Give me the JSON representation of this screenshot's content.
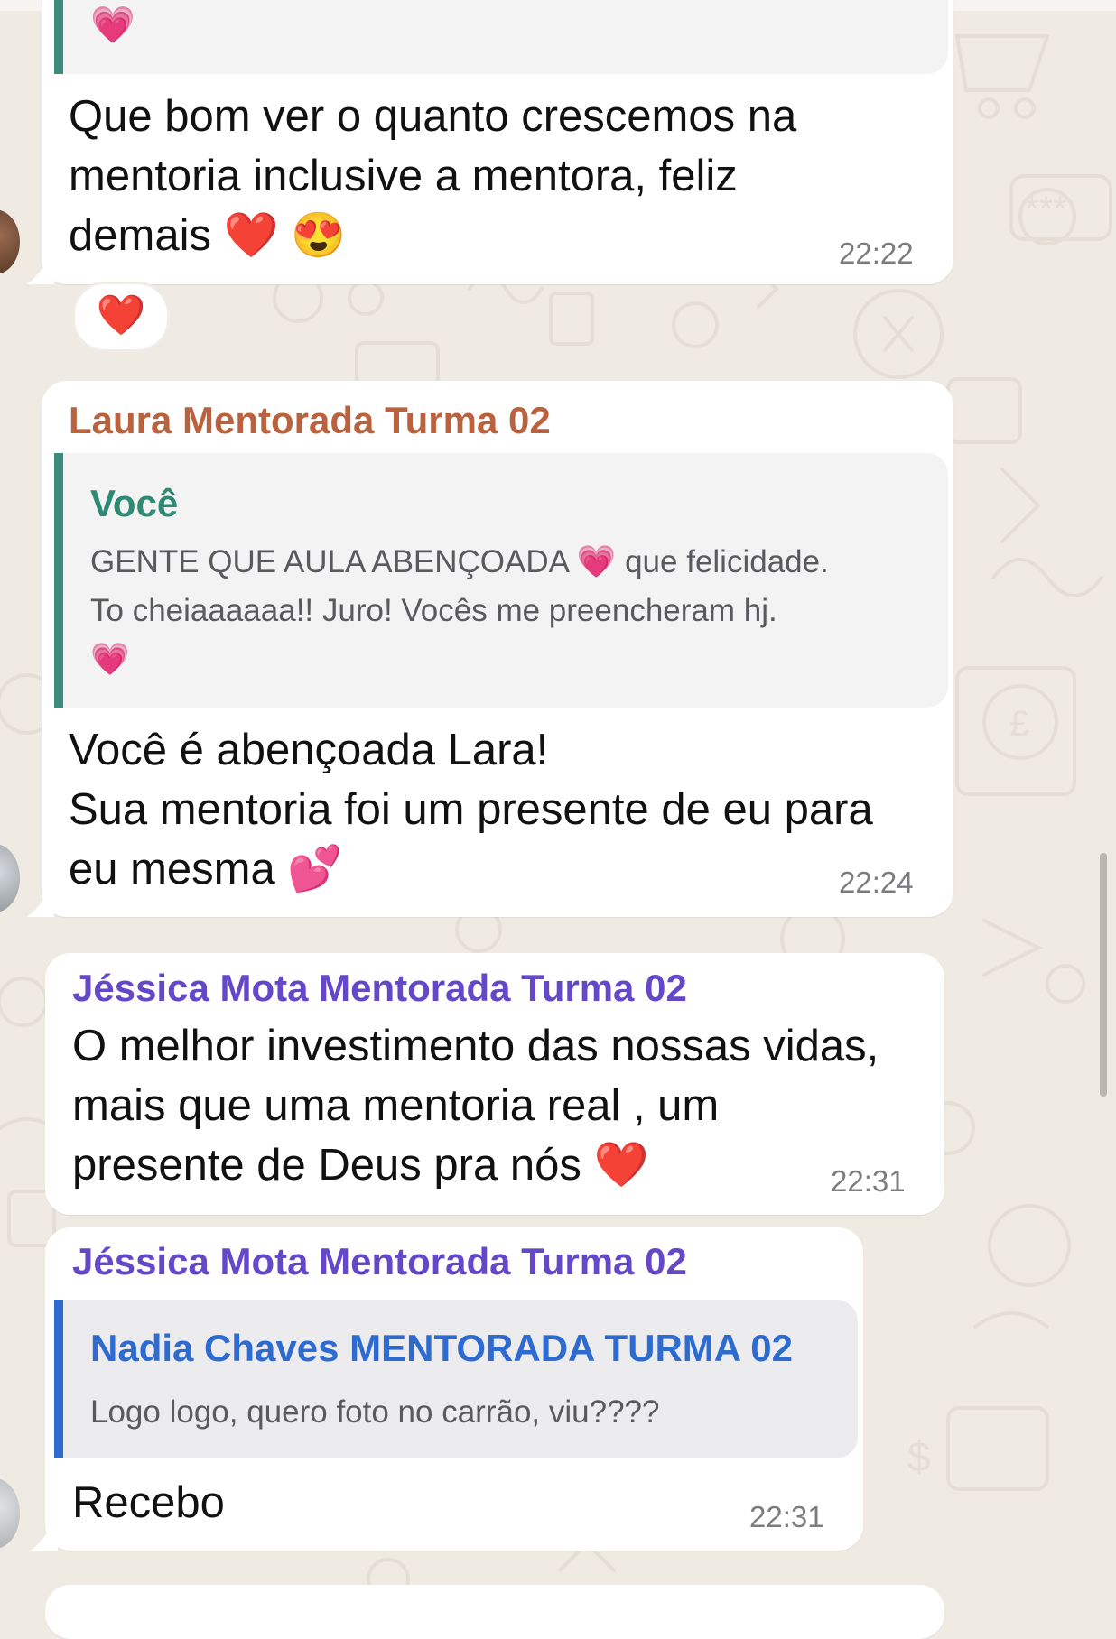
{
  "colors": {
    "background": "#efeae2",
    "bubble": "#ffffff",
    "sender_laura": "#b9623d",
    "sender_jessica": "#6448c9",
    "quote_voce": "#2f8a73",
    "quote_nadia": "#2d6bd1",
    "heart_red": "#e5202f",
    "heart_pink": "#ee6fd0"
  },
  "messages": [
    {
      "top_quote_tail": "💗",
      "text": "Que bom ver o quanto crescemos na\nmentoria inclusive a mentora, feliz\ndemais ❤️ 😍",
      "time": "22:22",
      "reaction": "❤️"
    },
    {
      "sender": "Laura Mentorada Turma 02",
      "quote_name": "Você",
      "quote_text": "GENTE QUE AULA ABENÇOADA 💗 que felicidade.\nTo cheiaaaaaa!! Juro! Vocês me preencheram hj.\n💗",
      "text": "Você é abençoada Lara!\nSua mentoria foi um presente de eu para\neu mesma 💕",
      "time": "22:24"
    },
    {
      "sender": "Jéssica Mota Mentorada Turma 02",
      "text": "O melhor investimento das nossas vidas,\nmais que uma mentoria real , um\npresente de Deus pra nós ❤️",
      "time": "22:31"
    },
    {
      "sender": "Jéssica Mota Mentorada Turma 02",
      "quote_name": "Nadia Chaves MENTORADA TURMA 02",
      "quote_text": "Logo logo, quero foto no carrão, viu????",
      "text": "Recebo",
      "time": "22:31"
    }
  ],
  "icons": [
    "avatar",
    "wallpaper-doodles",
    "scrollbar"
  ]
}
